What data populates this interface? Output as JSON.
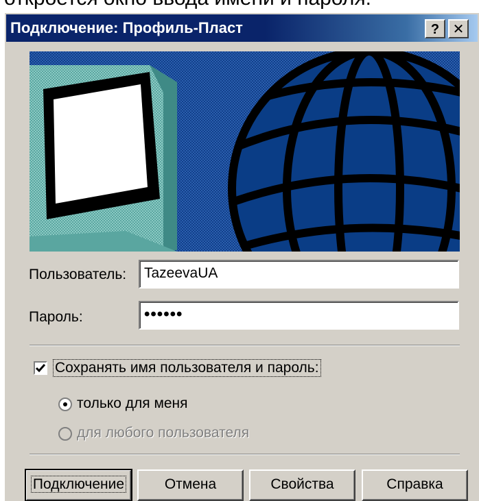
{
  "page_caption": "откроется окно ввода имени и пароля.",
  "window": {
    "title": "Подключение: Профиль-Пласт",
    "help_button": "?",
    "close_button": "✕"
  },
  "form": {
    "user_label": "Пользователь:",
    "user_value": "TazeevaUA",
    "password_label": "Пароль:",
    "password_value": "••••••"
  },
  "save_options": {
    "save_checkbox_label": "Сохранять имя пользователя и пароль:",
    "save_checked": true,
    "radio_only_me": "только для меня",
    "radio_any_user": "для любого пользователя",
    "selected": "only_me"
  },
  "buttons": {
    "connect": "Подключение",
    "cancel": "Отмена",
    "properties": "Свойства",
    "help": "Справка"
  },
  "colors": {
    "titlebar_start": "#0a246a",
    "dialog_face": "#d4d0c8",
    "banner_globe": "#0c3f8f"
  },
  "icons": {
    "banner": "monitor-and-globe-illustration"
  }
}
